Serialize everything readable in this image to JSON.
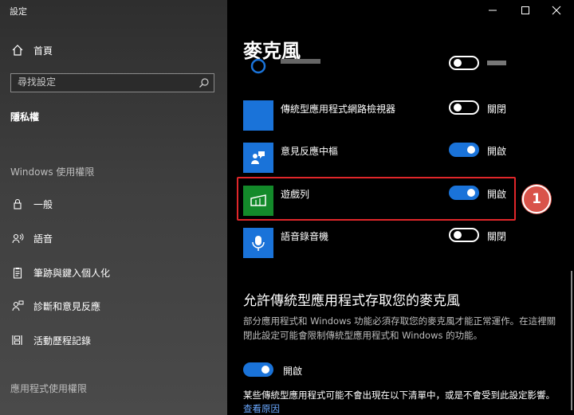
{
  "window": {
    "title": "設定"
  },
  "sidebar": {
    "home": "首頁",
    "search_placeholder": "尋找設定",
    "current_section": "隱私權",
    "section_windows": "Windows 使用權限",
    "items": [
      {
        "label": "一般",
        "icon": "lock-icon"
      },
      {
        "label": "語音",
        "icon": "speech-icon"
      },
      {
        "label": "筆跡與鍵入個人化",
        "icon": "clipboard-icon"
      },
      {
        "label": "診斷和意見反應",
        "icon": "feedback-icon"
      },
      {
        "label": "活動歷程記錄",
        "icon": "timeline-icon"
      }
    ],
    "section_apps": "應用程式使用權限"
  },
  "main": {
    "title": "麥克風",
    "apps": [
      {
        "name": "",
        "state": ""
      },
      {
        "name": "傳統型應用程式網路檢視器",
        "state": "關閉",
        "on": false,
        "icon_color": "#1a73d9"
      },
      {
        "name": "意見反應中樞",
        "state": "開啟",
        "on": true,
        "icon_color": "#1a73d9"
      },
      {
        "name": "遊戲列",
        "state": "開啟",
        "on": true,
        "icon_color": "#138a2a"
      },
      {
        "name": "語音錄音機",
        "state": "關閉",
        "on": false,
        "icon_color": "#1a73d9"
      }
    ],
    "legacy_heading": "允許傳統型應用程式存取您的麥克風",
    "legacy_desc": "部分應用程式和 Windows 功能必須存取您的麥克風才能正常運作。在這裡關閉此設定可能會限制傳統型應用程式和 Windows 的功能。",
    "legacy_toggle_state": "開啟",
    "note_text": "某些傳統型應用程式可能不會出現在以下清單中，或是不會受到此設定影響。",
    "note_link": "查看原因"
  },
  "annotation": {
    "badge": "1"
  },
  "colors": {
    "accent": "#1a73d9",
    "highlight": "#e0262a",
    "badge": "#d9534a",
    "xbox_green": "#138a2a"
  }
}
